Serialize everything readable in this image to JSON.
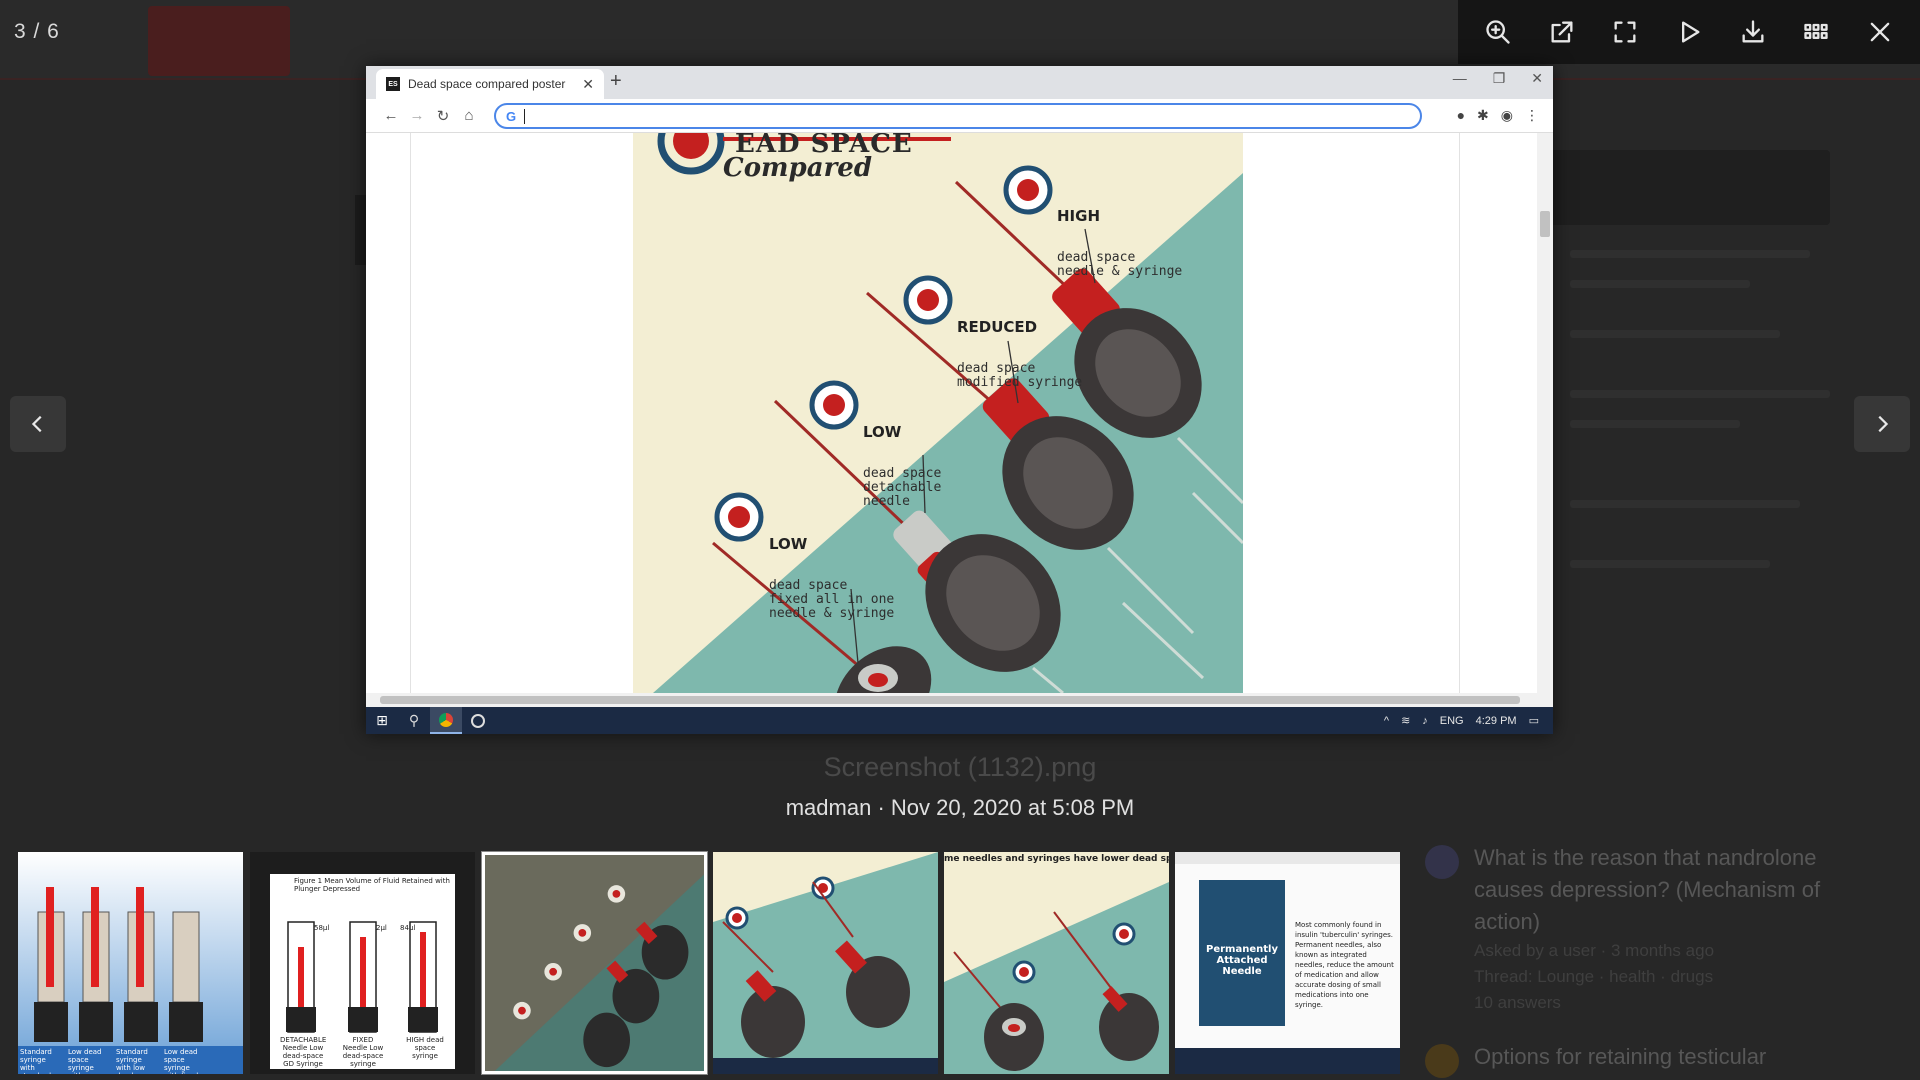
{
  "viewer": {
    "counter": "3 / 6",
    "toolbar": [
      "zoom-in",
      "open-in-new-window",
      "fullscreen",
      "slideshow",
      "download",
      "grid-view",
      "close"
    ],
    "caption_title": "Screenshot (1132).png",
    "caption_meta": "madman · Nov 20, 2020 at 5:08 PM"
  },
  "browser": {
    "tab_favicon": "ES",
    "tab_title": "Dead space compared poster",
    "address_value": "",
    "taskbar": {
      "lang": "ENG",
      "time": "4:29 PM"
    }
  },
  "poster": {
    "title_line1": "EAD SPACE",
    "title_line2": "Compared",
    "labels": [
      {
        "heading": "HIGH",
        "lines": "dead space\nneedle & syringe"
      },
      {
        "heading": "REDUCED",
        "lines": "dead space\nmodified syringe"
      },
      {
        "heading": "LOW",
        "lines": "dead space\ndetachable\nneedle"
      },
      {
        "heading": "LOW",
        "lines": "dead space\nfixed all in one\nneedle & syringe"
      }
    ],
    "colors": {
      "cream": "#f3eed3",
      "teal": "#7eb8ad",
      "red": "#c4201f",
      "navy": "#214f72",
      "dark": "#3a3a3a"
    }
  },
  "thumbnails": [
    {
      "name": "syringe-comparison",
      "labels": [
        "Standard syringe with standard needle",
        "Low dead space syringe with standard needle",
        "Standard syringe with low dead space needle",
        "Low dead space syringe with fixed needle"
      ]
    },
    {
      "name": "figure-1",
      "title": "Figure 1 Mean Volume of Fluid Retained with Plunger Depressed",
      "values": [
        "58µl",
        "2µl",
        "84µl"
      ],
      "labels": [
        "DETACHABLE Needle Low dead-space GD Syringe",
        "FIXED Needle Low dead-space syringe",
        "HIGH dead space syringe"
      ]
    },
    {
      "name": "dead-space-poster",
      "selected": true
    },
    {
      "name": "poster-crop-high-reduced"
    },
    {
      "name": "poster-crop-low",
      "banner": "me needles and syringes have lower dead space than others"
    },
    {
      "name": "permanently-attached-needle",
      "box": "Permanently Attached Needle",
      "text": "Most commonly found in insulin 'tuberculin' syringes. Permanent needles, also known as integrated needles, reduce the amount of medication and allow accurate dosing of small medications into one syringe."
    }
  ],
  "background": {
    "question1": "What is the reason that nandrolone causes depression? (Mechanism of action)",
    "question1_meta": "Asked by a user · 3 months ago",
    "question1_meta2": "Thread: Lounge · health · drugs",
    "question1_meta3": "10 answers",
    "question2": "Options for retaining testicular"
  }
}
